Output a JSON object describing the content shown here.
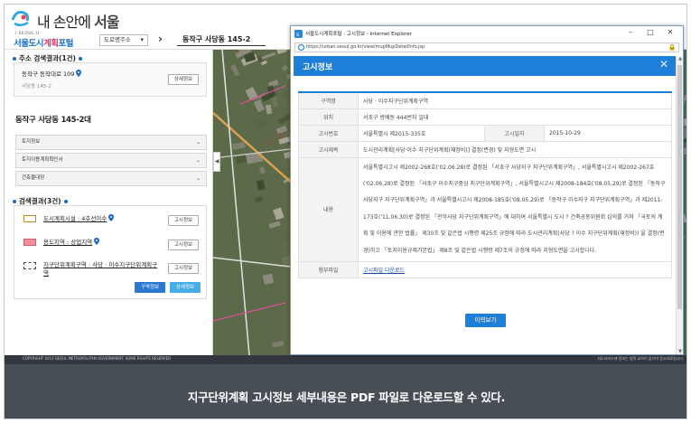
{
  "banner": {
    "prefix": "내 손안에 ",
    "strong": "서울"
  },
  "portal": {
    "brand_small": "i·SEOUL·U",
    "title_a": "서울도시",
    "title_b": "계획",
    "title_c": "포털",
    "addr_select": "도로명주소",
    "location": "동작구 사당동 145-2"
  },
  "left": {
    "addr_section": "주소 검색결과(1건)",
    "road_addr": "동작구 동작대로 109",
    "jibun": "사당동 145-2",
    "detail_btn": "상세정보",
    "big_addr": "동작구 사당동 145-2대",
    "accordions": [
      "토지정보",
      "토지이용계획확인서",
      "건축물대장"
    ],
    "results_section": "검색결과(3건)",
    "results": [
      {
        "label": "도시계획시설 : 4호선이수",
        "btn": "고시정보"
      },
      {
        "label": "용도지역 : 상업지역",
        "btn": "고시정보"
      },
      {
        "label": "지구단위계획구역 : 사당 · 이수지구단위계획구역",
        "btn": "고시정보"
      }
    ],
    "area_btn": "구역정보",
    "detail_btn2": "상세정보",
    "collapse": "◀"
  },
  "footer": {
    "copyright": "COPYRIGHT 2011 SEOUL METROPOLITAN GOVERNMENT. SOME RIGHTS RESERVED",
    "note": "지도서비스에 정보는 법적 효력이 없으며 참고자료입니다"
  },
  "popup": {
    "window_title": "서울도시계획포털 : 고시정보 - Internet Explorer",
    "url": "https://urban.seoul.go.kr/view/mupMupDetailInfo.jsp",
    "dialog_title": "고시정보",
    "rows": {
      "zone_name_label": "구역명",
      "zone_name": "사당 · 이수지구단위계획구역",
      "location_label": "위치",
      "location": "서초구 방배동 444번지 일대",
      "notice_no_label": "고시번호",
      "notice_no": "서울특별시 제2015-335호",
      "notice_date_label": "고시일자",
      "notice_date": "2015-10-29",
      "subject_label": "고시제목",
      "subject": "도시관리계획[사당·이수 지구단위계획(재정비)] 결정(변경) 및 지형도면 고시",
      "content_label": "내용",
      "content": "서울특별시고시 제2002-268호('02.06.28)로 결정된 「서초구 사당지구 지구단위계획구역」, 서울특별시고시 제2002-267호('02.06.28)로 결정된 「서초구 이수지구중심 지구단위계획구역」, 서울특별시고시 제2008-184호('08.05.29)로 결정된 「동작구 사당지구 지구단위계획구역」과 서울특별시고시 제2008-185호('08.05.29)로 「동작구 이수지구 지구단위계획구역」과 제2011-173호('11.06.30)로 결정된 「관악사당 지구단위계획구역」에 대하여 서울특별시 도시 ? 건축공동위원회 심의를 거쳐 「국토의 계획 및 이용에 관한 법률」 제30조 및 같은법 시행령 제25조 규정에 따라 도시관리계획(사당 ? 이수 지구단위계획(재정비)) 을 결정(변경)하고 「토지이용규제기본법」 제8조 및 같은법 시행령 제7조의 규정에 따라 지형도면을 고시합니다.",
      "file_label": "첨부파일",
      "file": "고시파일 다운로드"
    },
    "history_btn": "이력보기"
  },
  "caption": "지구단위계획 고시정보 세부내용은 PDF 파일로 다운로드할 수 있다.",
  "colors": {
    "accent": "#1e7fd9",
    "pink_swatch": "#f08c9c",
    "caption_bg": "#484e56"
  }
}
